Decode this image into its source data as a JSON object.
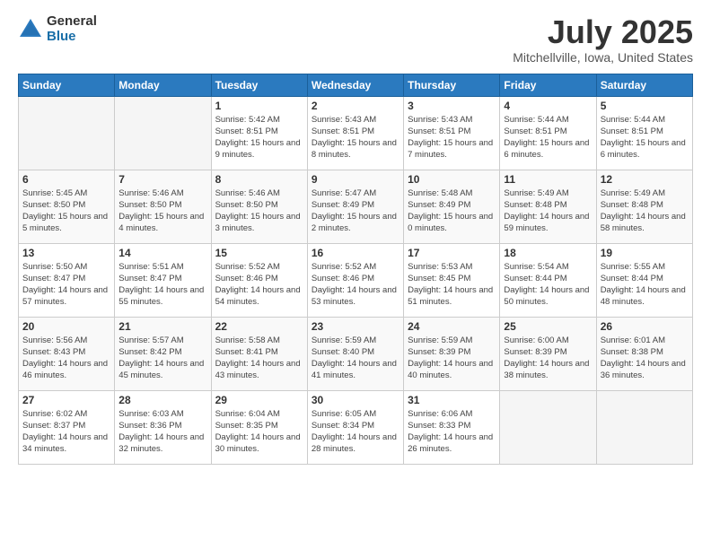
{
  "logo": {
    "general": "General",
    "blue": "Blue"
  },
  "header": {
    "title": "July 2025",
    "subtitle": "Mitchellville, Iowa, United States"
  },
  "weekdays": [
    "Sunday",
    "Monday",
    "Tuesday",
    "Wednesday",
    "Thursday",
    "Friday",
    "Saturday"
  ],
  "weeks": [
    [
      {
        "day": "",
        "sunrise": "",
        "sunset": "",
        "daylight": ""
      },
      {
        "day": "",
        "sunrise": "",
        "sunset": "",
        "daylight": ""
      },
      {
        "day": "1",
        "sunrise": "Sunrise: 5:42 AM",
        "sunset": "Sunset: 8:51 PM",
        "daylight": "Daylight: 15 hours and 9 minutes."
      },
      {
        "day": "2",
        "sunrise": "Sunrise: 5:43 AM",
        "sunset": "Sunset: 8:51 PM",
        "daylight": "Daylight: 15 hours and 8 minutes."
      },
      {
        "day": "3",
        "sunrise": "Sunrise: 5:43 AM",
        "sunset": "Sunset: 8:51 PM",
        "daylight": "Daylight: 15 hours and 7 minutes."
      },
      {
        "day": "4",
        "sunrise": "Sunrise: 5:44 AM",
        "sunset": "Sunset: 8:51 PM",
        "daylight": "Daylight: 15 hours and 6 minutes."
      },
      {
        "day": "5",
        "sunrise": "Sunrise: 5:44 AM",
        "sunset": "Sunset: 8:51 PM",
        "daylight": "Daylight: 15 hours and 6 minutes."
      }
    ],
    [
      {
        "day": "6",
        "sunrise": "Sunrise: 5:45 AM",
        "sunset": "Sunset: 8:50 PM",
        "daylight": "Daylight: 15 hours and 5 minutes."
      },
      {
        "day": "7",
        "sunrise": "Sunrise: 5:46 AM",
        "sunset": "Sunset: 8:50 PM",
        "daylight": "Daylight: 15 hours and 4 minutes."
      },
      {
        "day": "8",
        "sunrise": "Sunrise: 5:46 AM",
        "sunset": "Sunset: 8:50 PM",
        "daylight": "Daylight: 15 hours and 3 minutes."
      },
      {
        "day": "9",
        "sunrise": "Sunrise: 5:47 AM",
        "sunset": "Sunset: 8:49 PM",
        "daylight": "Daylight: 15 hours and 2 minutes."
      },
      {
        "day": "10",
        "sunrise": "Sunrise: 5:48 AM",
        "sunset": "Sunset: 8:49 PM",
        "daylight": "Daylight: 15 hours and 0 minutes."
      },
      {
        "day": "11",
        "sunrise": "Sunrise: 5:49 AM",
        "sunset": "Sunset: 8:48 PM",
        "daylight": "Daylight: 14 hours and 59 minutes."
      },
      {
        "day": "12",
        "sunrise": "Sunrise: 5:49 AM",
        "sunset": "Sunset: 8:48 PM",
        "daylight": "Daylight: 14 hours and 58 minutes."
      }
    ],
    [
      {
        "day": "13",
        "sunrise": "Sunrise: 5:50 AM",
        "sunset": "Sunset: 8:47 PM",
        "daylight": "Daylight: 14 hours and 57 minutes."
      },
      {
        "day": "14",
        "sunrise": "Sunrise: 5:51 AM",
        "sunset": "Sunset: 8:47 PM",
        "daylight": "Daylight: 14 hours and 55 minutes."
      },
      {
        "day": "15",
        "sunrise": "Sunrise: 5:52 AM",
        "sunset": "Sunset: 8:46 PM",
        "daylight": "Daylight: 14 hours and 54 minutes."
      },
      {
        "day": "16",
        "sunrise": "Sunrise: 5:52 AM",
        "sunset": "Sunset: 8:46 PM",
        "daylight": "Daylight: 14 hours and 53 minutes."
      },
      {
        "day": "17",
        "sunrise": "Sunrise: 5:53 AM",
        "sunset": "Sunset: 8:45 PM",
        "daylight": "Daylight: 14 hours and 51 minutes."
      },
      {
        "day": "18",
        "sunrise": "Sunrise: 5:54 AM",
        "sunset": "Sunset: 8:44 PM",
        "daylight": "Daylight: 14 hours and 50 minutes."
      },
      {
        "day": "19",
        "sunrise": "Sunrise: 5:55 AM",
        "sunset": "Sunset: 8:44 PM",
        "daylight": "Daylight: 14 hours and 48 minutes."
      }
    ],
    [
      {
        "day": "20",
        "sunrise": "Sunrise: 5:56 AM",
        "sunset": "Sunset: 8:43 PM",
        "daylight": "Daylight: 14 hours and 46 minutes."
      },
      {
        "day": "21",
        "sunrise": "Sunrise: 5:57 AM",
        "sunset": "Sunset: 8:42 PM",
        "daylight": "Daylight: 14 hours and 45 minutes."
      },
      {
        "day": "22",
        "sunrise": "Sunrise: 5:58 AM",
        "sunset": "Sunset: 8:41 PM",
        "daylight": "Daylight: 14 hours and 43 minutes."
      },
      {
        "day": "23",
        "sunrise": "Sunrise: 5:59 AM",
        "sunset": "Sunset: 8:40 PM",
        "daylight": "Daylight: 14 hours and 41 minutes."
      },
      {
        "day": "24",
        "sunrise": "Sunrise: 5:59 AM",
        "sunset": "Sunset: 8:39 PM",
        "daylight": "Daylight: 14 hours and 40 minutes."
      },
      {
        "day": "25",
        "sunrise": "Sunrise: 6:00 AM",
        "sunset": "Sunset: 8:39 PM",
        "daylight": "Daylight: 14 hours and 38 minutes."
      },
      {
        "day": "26",
        "sunrise": "Sunrise: 6:01 AM",
        "sunset": "Sunset: 8:38 PM",
        "daylight": "Daylight: 14 hours and 36 minutes."
      }
    ],
    [
      {
        "day": "27",
        "sunrise": "Sunrise: 6:02 AM",
        "sunset": "Sunset: 8:37 PM",
        "daylight": "Daylight: 14 hours and 34 minutes."
      },
      {
        "day": "28",
        "sunrise": "Sunrise: 6:03 AM",
        "sunset": "Sunset: 8:36 PM",
        "daylight": "Daylight: 14 hours and 32 minutes."
      },
      {
        "day": "29",
        "sunrise": "Sunrise: 6:04 AM",
        "sunset": "Sunset: 8:35 PM",
        "daylight": "Daylight: 14 hours and 30 minutes."
      },
      {
        "day": "30",
        "sunrise": "Sunrise: 6:05 AM",
        "sunset": "Sunset: 8:34 PM",
        "daylight": "Daylight: 14 hours and 28 minutes."
      },
      {
        "day": "31",
        "sunrise": "Sunrise: 6:06 AM",
        "sunset": "Sunset: 8:33 PM",
        "daylight": "Daylight: 14 hours and 26 minutes."
      },
      {
        "day": "",
        "sunrise": "",
        "sunset": "",
        "daylight": ""
      },
      {
        "day": "",
        "sunrise": "",
        "sunset": "",
        "daylight": ""
      }
    ]
  ]
}
